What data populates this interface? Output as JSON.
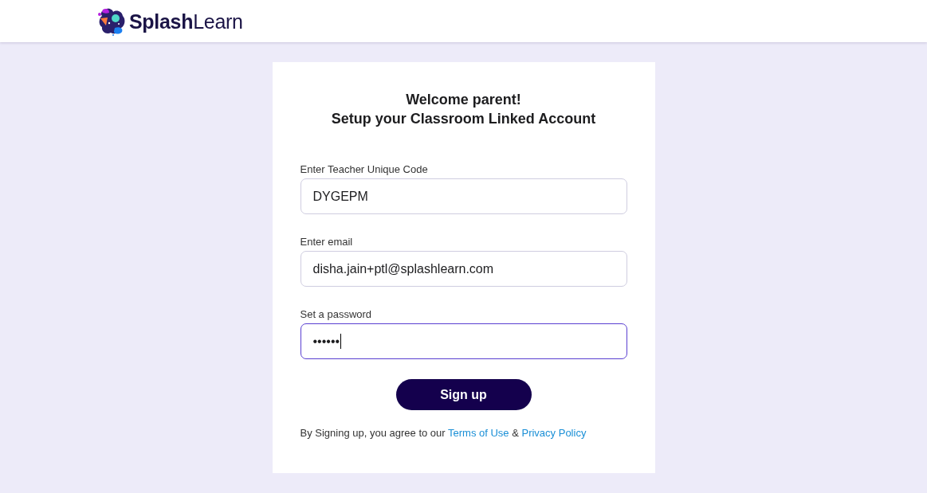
{
  "header": {
    "logo": {
      "text": "**Splash**Learn"
    }
  },
  "form": {
    "title_lines": [
      "Welcome parent!",
      "Setup your Classroom Linked Account"
    ],
    "fields": [
      {
        "label": "Enter Teacher Unique Code",
        "value": "DYGEPM",
        "focused": false
      },
      {
        "label": "Enter email",
        "value": "disha.jain+ptl@splashlearn.com",
        "focused": false
      },
      {
        "label": "Set a password",
        "value": "••••••",
        "focused": true
      }
    ],
    "submit_button": "Sign up",
    "terms": {
      "prefix": "By Signing up, you agree to our",
      "terms_link": "Terms of Use",
      "joiner": "&",
      "privacy_link": "Privacy Policy"
    }
  }
}
